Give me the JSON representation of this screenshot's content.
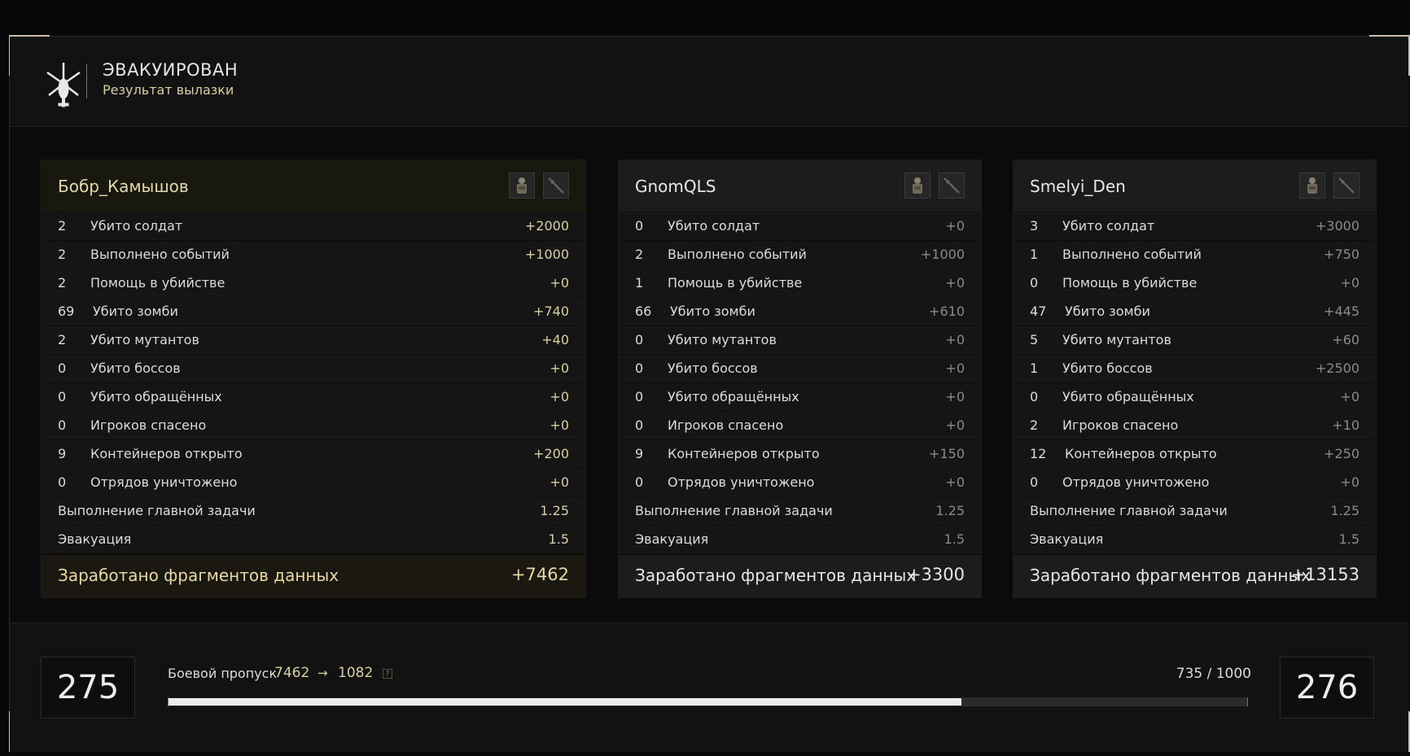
{
  "header": {
    "title": "ЭВАКУИРОВАН",
    "subtitle": "Результат вылазки",
    "icon": "helicopter-icon"
  },
  "players": [
    {
      "name": "Бобр_Камышов",
      "stats": [
        {
          "count": "2",
          "label": "Убито солдат",
          "value": "+2000"
        },
        {
          "count": "2",
          "label": "Выполнено событий",
          "value": "+1000"
        },
        {
          "count": "2",
          "label": "Помощь в убийстве",
          "value": "+0"
        },
        {
          "count": "69",
          "label": "Убито зомби",
          "value": "+740"
        },
        {
          "count": "2",
          "label": "Убито мутантов",
          "value": "+40"
        },
        {
          "count": "0",
          "label": "Убито боссов",
          "value": "+0"
        },
        {
          "count": "0",
          "label": "Убито обращённых",
          "value": "+0"
        },
        {
          "count": "0",
          "label": "Игроков спасено",
          "value": "+0"
        },
        {
          "count": "9",
          "label": "Контейнеров открыто",
          "value": "+200"
        },
        {
          "count": "0",
          "label": "Отрядов уничтожено",
          "value": "+0"
        }
      ],
      "multipliers": [
        {
          "label": "Выполнение главной задачи",
          "value": "1.25"
        },
        {
          "label": "Эвакуация",
          "value": "1.5"
        }
      ],
      "total_label": "Заработано фрагментов данных",
      "total_value": "+7462"
    },
    {
      "name": "GnomQLS",
      "stats": [
        {
          "count": "0",
          "label": "Убито солдат",
          "value": "+0"
        },
        {
          "count": "2",
          "label": "Выполнено событий",
          "value": "+1000"
        },
        {
          "count": "1",
          "label": "Помощь в убийстве",
          "value": "+0"
        },
        {
          "count": "66",
          "label": "Убито зомби",
          "value": "+610"
        },
        {
          "count": "0",
          "label": "Убито мутантов",
          "value": "+0"
        },
        {
          "count": "0",
          "label": "Убито боссов",
          "value": "+0"
        },
        {
          "count": "0",
          "label": "Убито обращённых",
          "value": "+0"
        },
        {
          "count": "0",
          "label": "Игроков спасено",
          "value": "+0"
        },
        {
          "count": "9",
          "label": "Контейнеров открыто",
          "value": "+150"
        },
        {
          "count": "0",
          "label": "Отрядов уничтожено",
          "value": "+0"
        }
      ],
      "multipliers": [
        {
          "label": "Выполнение главной задачи",
          "value": "1.25"
        },
        {
          "label": "Эвакуация",
          "value": "1.5"
        }
      ],
      "total_label": "Заработано фрагментов данных",
      "total_value": "+3300"
    },
    {
      "name": "Smelyi_Den",
      "stats": [
        {
          "count": "3",
          "label": "Убито солдат",
          "value": "+3000"
        },
        {
          "count": "1",
          "label": "Выполнено событий",
          "value": "+750"
        },
        {
          "count": "0",
          "label": "Помощь в убийстве",
          "value": "+0"
        },
        {
          "count": "47",
          "label": "Убито зомби",
          "value": "+445"
        },
        {
          "count": "5",
          "label": "Убито мутантов",
          "value": "+60"
        },
        {
          "count": "1",
          "label": "Убито боссов",
          "value": "+2500"
        },
        {
          "count": "0",
          "label": "Убито обращённых",
          "value": "+0"
        },
        {
          "count": "2",
          "label": "Игроков спасено",
          "value": "+10"
        },
        {
          "count": "12",
          "label": "Контейнеров открыто",
          "value": "+250"
        },
        {
          "count": "0",
          "label": "Отрядов уничтожено",
          "value": "+0"
        }
      ],
      "multipliers": [
        {
          "label": "Выполнение главной задачи",
          "value": "1.25"
        },
        {
          "label": "Эвакуация",
          "value": "1.5"
        }
      ],
      "total_label": "Заработано фрагментов данных",
      "total_value": "+13153"
    }
  ],
  "battle_pass": {
    "current_level": "275",
    "next_level": "276",
    "label": "Боевой пропуск",
    "from": "7462",
    "arrow": "→",
    "to": "1082",
    "help": "?",
    "progress_text": "735 / 1000",
    "progress_fraction": 0.735
  },
  "colors": {
    "accent_gold": "#d9cfa2",
    "muted_value": "#8b8b8b",
    "bar_fill": "#ececec"
  }
}
